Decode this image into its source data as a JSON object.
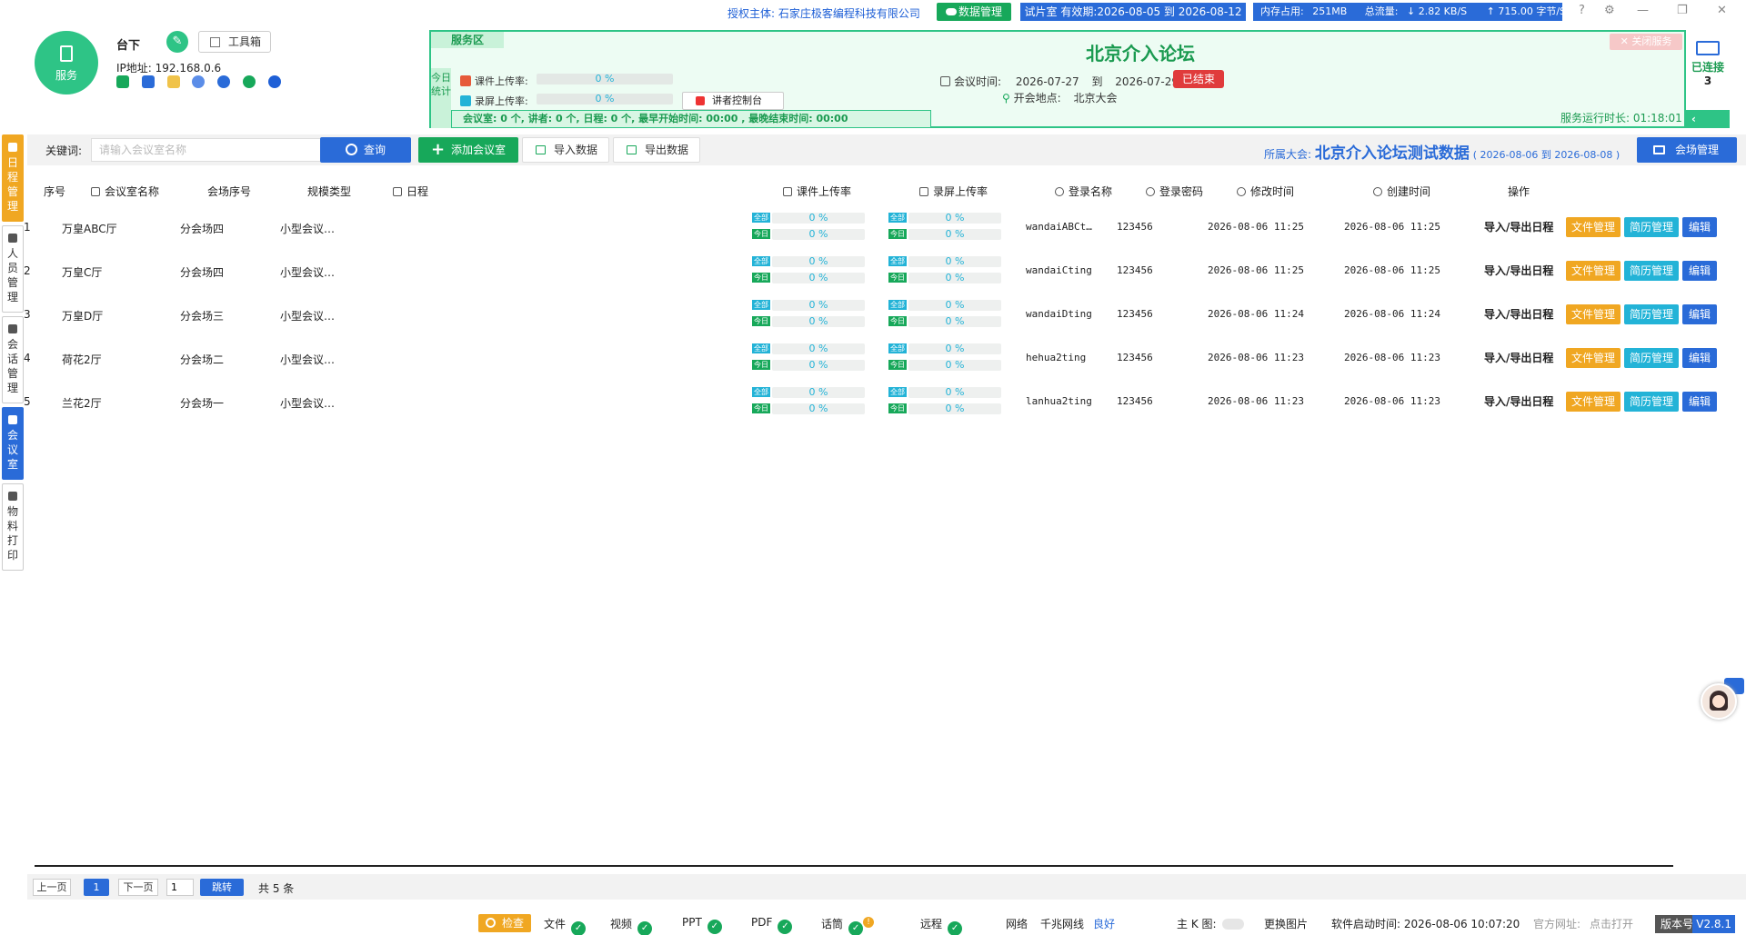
{
  "top": {
    "auth": "授权主体: 石家庄极客编程科技有限公司",
    "data_mgmt": "数据管理",
    "trial": "试片室 有效期:2026-08-05 到 2026-08-12",
    "mem": "内存占用:",
    "mem_val": "251MB",
    "flow": "总流量:",
    "down": "↓ 2.82 KB/S",
    "up": "↑ 715.00 字节/S"
  },
  "header": {
    "service_label": "服务",
    "name": "台下",
    "toolbox": "工具箱",
    "ip": "IP地址: 192.168.0.6"
  },
  "service_panel": {
    "tab": "服务区",
    "today": "今日统计",
    "courseware_label": "课件上传率:",
    "courseware_val": "0 %",
    "record_label": "录屏上传率:",
    "record_val": "0 %",
    "speaker_console": "讲者控制台",
    "stats": "会议室:  0 个,  讲者:  0 个,  日程:  0 个,  最早开始时间:  00:00 ,   最晚结束时间:  00:00",
    "forum_title": "北京介入论坛",
    "meeting_time_label": "会议时间:",
    "meeting_start": "2026-07-27",
    "to": "到",
    "meeting_end": "2026-07-29",
    "ended": "已结束",
    "place_label": "开会地点:",
    "place": "北京大会",
    "close_service": "✕ 关闭服务",
    "runtime": "服务运行时长: 01:18:01",
    "connected": "已连接",
    "connected_count": "3"
  },
  "left_nav": [
    {
      "label": "日程管理"
    },
    {
      "label": "人员管理"
    },
    {
      "label": "会话管理"
    },
    {
      "label": "会议室"
    },
    {
      "label": "物料打印"
    }
  ],
  "toolbar": {
    "keyword_label": "关键词:",
    "search_placeholder": "请输入会议室名称",
    "query": "查询",
    "add_room": "添加会议室",
    "import": "导入数据",
    "export": "导出数据",
    "conf_prefix": "所属大会:",
    "conf_name": "北京介入论坛测试数据",
    "conf_dates": "( 2026-08-06 到 2026-08-08 )",
    "venue_mgmt": "会场管理"
  },
  "table": {
    "headers": {
      "seq": "序号",
      "room": "会议室名称",
      "venue": "会场序号",
      "scale": "规模类型",
      "schedule": "日程",
      "cw_rate": "课件上传率",
      "rec_rate": "录屏上传率",
      "login": "登录名称",
      "pwd": "登录密码",
      "modified": "修改时间",
      "created": "创建时间",
      "ops": "操作"
    },
    "tag_all": "全部",
    "tag_today": "今日",
    "op_io": "导入/导出日程",
    "op_file": "文件管理",
    "op_cv": "简历管理",
    "op_edit": "编辑",
    "rows": [
      {
        "seq": "1",
        "room": "万皇ABC厅",
        "venue": "分会场四",
        "scale": "小型会议…",
        "cw_all": "0 %",
        "cw_today": "0 %",
        "rec_all": "0 %",
        "rec_today": "0 %",
        "login": "wandaiABCt…",
        "pwd": "123456",
        "modified": "2026-08-06 11:25",
        "created": "2026-08-06 11:25"
      },
      {
        "seq": "2",
        "room": "万皇C厅",
        "venue": "分会场四",
        "scale": "小型会议…",
        "cw_all": "0 %",
        "cw_today": "0 %",
        "rec_all": "0 %",
        "rec_today": "0 %",
        "login": "wandaiCting",
        "pwd": "123456",
        "modified": "2026-08-06 11:25",
        "created": "2026-08-06 11:25"
      },
      {
        "seq": "3",
        "room": "万皇D厅",
        "venue": "分会场三",
        "scale": "小型会议…",
        "cw_all": "0 %",
        "cw_today": "0 %",
        "rec_all": "0 %",
        "rec_today": "0 %",
        "login": "wandaiDting",
        "pwd": "123456",
        "modified": "2026-08-06 11:24",
        "created": "2026-08-06 11:24"
      },
      {
        "seq": "4",
        "room": "荷花2厅",
        "venue": "分会场二",
        "scale": "小型会议…",
        "cw_all": "0 %",
        "cw_today": "0 %",
        "rec_all": "0 %",
        "rec_today": "0 %",
        "login": "hehua2ting",
        "pwd": "123456",
        "modified": "2026-08-06 11:23",
        "created": "2026-08-06 11:23"
      },
      {
        "seq": "5",
        "room": "兰花2厅",
        "venue": "分会场一",
        "scale": "小型会议…",
        "cw_all": "0 %",
        "cw_today": "0 %",
        "rec_all": "0 %",
        "rec_today": "0 %",
        "login": "lanhua2ting",
        "pwd": "123456",
        "modified": "2026-08-06 11:23",
        "created": "2026-08-06 11:23"
      }
    ]
  },
  "pager": {
    "prev": "上一页",
    "current": "1",
    "next": "下一页",
    "input": "1",
    "jump": "跳转",
    "total": "共 5 条"
  },
  "status": {
    "check": "检查",
    "file": "文件",
    "video": "视频",
    "ppt": "PPT",
    "pdf": "PDF",
    "mic": "话筒",
    "remote": "远程",
    "network": "网络",
    "network_type": "千兆网线",
    "network_quality": "良好",
    "main_k": "主 K 图:",
    "change_pic": "更换图片",
    "start_time": "软件启动时间: 2026-08-06 10:07:20",
    "official_label": "官方网址:",
    "official_link": "点击打开",
    "version_label": "版本号",
    "version": "V2.8.1"
  },
  "colors": {
    "green": "#2ec486",
    "blue": "#2a6bd8",
    "orange": "#f0a722",
    "cyan": "#23b3d7",
    "red": "#e03b3b"
  }
}
